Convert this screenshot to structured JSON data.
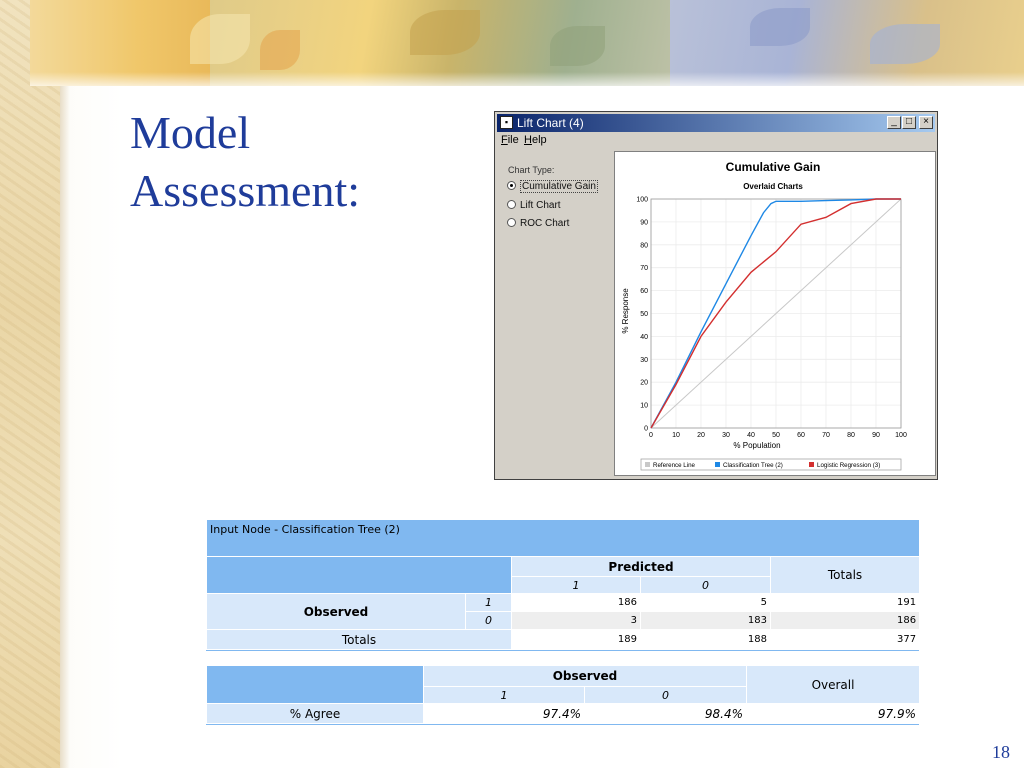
{
  "slide": {
    "title_line1": "Model",
    "title_line2": "Assessment:",
    "page_number": "18"
  },
  "lift_window": {
    "title": "Lift Chart (4)",
    "menu": [
      {
        "label": "File",
        "mnemonic": "F",
        "rest": "ile"
      },
      {
        "label": "Help",
        "mnemonic": "H",
        "rest": "elp"
      }
    ],
    "controls": {
      "minimize": "_",
      "maximize": "□",
      "close": "×"
    },
    "chart_type_label": "Chart Type:",
    "chart_types": [
      {
        "label": "Cumulative Gain",
        "selected": true
      },
      {
        "label": "Lift Chart",
        "selected": false
      },
      {
        "label": "ROC Chart",
        "selected": false
      }
    ]
  },
  "chart_data": {
    "type": "line",
    "title": "Cumulative Gain",
    "subtitle": "Overlaid Charts",
    "xlabel": "% Population",
    "ylabel": "% Response",
    "xlim": [
      0,
      100
    ],
    "ylim": [
      0,
      100
    ],
    "x_ticks": [
      0,
      10,
      20,
      30,
      40,
      50,
      60,
      70,
      80,
      90,
      100
    ],
    "y_ticks": [
      0,
      10,
      20,
      30,
      40,
      50,
      60,
      70,
      80,
      90,
      100
    ],
    "grid": true,
    "legend_position": "bottom",
    "series": [
      {
        "name": "Reference Line",
        "color": "#c8c8c8",
        "x": [
          0,
          100
        ],
        "y": [
          0,
          100
        ]
      },
      {
        "name": "Classification Tree (2)",
        "color": "#1e88e5",
        "x": [
          0,
          10,
          20,
          30,
          40,
          45,
          48,
          50,
          60,
          70,
          80,
          90,
          100
        ],
        "y": [
          0,
          20,
          42,
          63,
          84,
          94,
          98,
          99,
          99,
          99.3,
          99.6,
          100,
          100
        ]
      },
      {
        "name": "Logistic Regression (3)",
        "color": "#d32f2f",
        "x": [
          0,
          10,
          20,
          30,
          40,
          50,
          60,
          70,
          80,
          90,
          100
        ],
        "y": [
          0,
          19,
          40,
          55,
          68,
          77,
          89,
          92,
          98,
          100,
          100
        ]
      }
    ]
  },
  "confusion_table": {
    "header": "Input Node - Classification Tree (2)",
    "predicted_label": "Predicted",
    "totals_col_label": "Totals",
    "pred_classes": [
      "1",
      "0"
    ],
    "observed_label": "Observed",
    "rows": [
      {
        "class": "1",
        "values": [
          "186",
          "5"
        ],
        "total": "191"
      },
      {
        "class": "0",
        "values": [
          "3",
          "183"
        ],
        "total": "186"
      }
    ],
    "totals_row_label": "Totals",
    "totals_row": [
      "189",
      "188",
      "377"
    ]
  },
  "agreement_table": {
    "observed_label": "Observed",
    "overall_label": "Overall",
    "classes": [
      "1",
      "0"
    ],
    "row_label": "% Agree",
    "values": [
      "97.4%",
      "98.4%",
      "97.9%"
    ]
  }
}
